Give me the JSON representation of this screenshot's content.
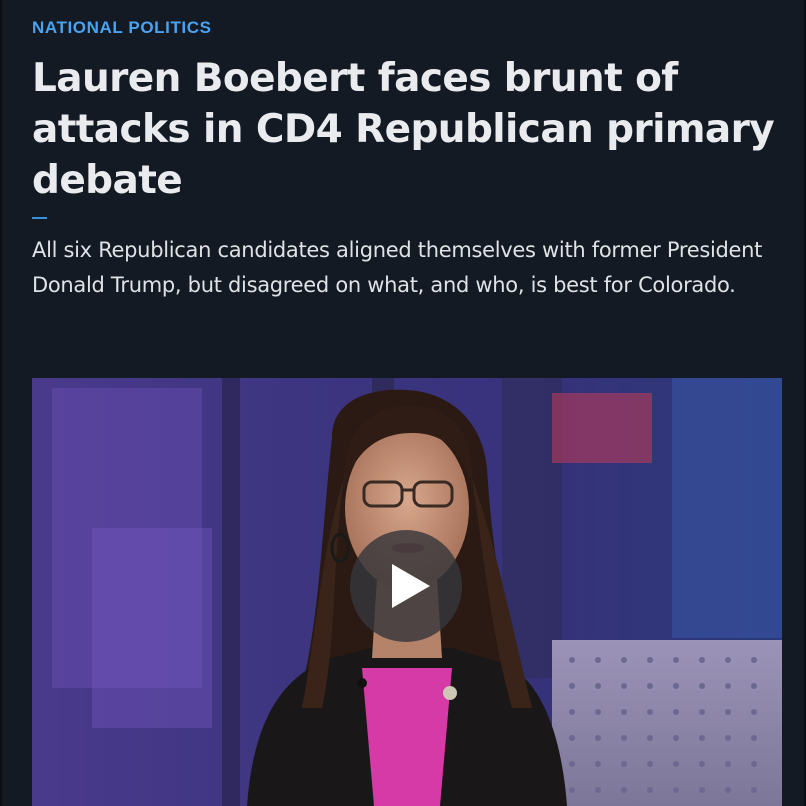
{
  "article": {
    "category": "NATIONAL POLITICS",
    "headline": "Lauren Boebert faces brunt of attacks in CD4 Republican primary debate",
    "dek": "All six Republican candidates aligned themselves with former President Donald Trump, but disagreed on what, and who, is best for Colorado."
  },
  "video": {
    "play_icon": "play-icon",
    "colors": {
      "background": "#131a23",
      "category": "#4aa3f2",
      "headline": "#e9ebee",
      "play_overlay": "#37373c"
    }
  }
}
